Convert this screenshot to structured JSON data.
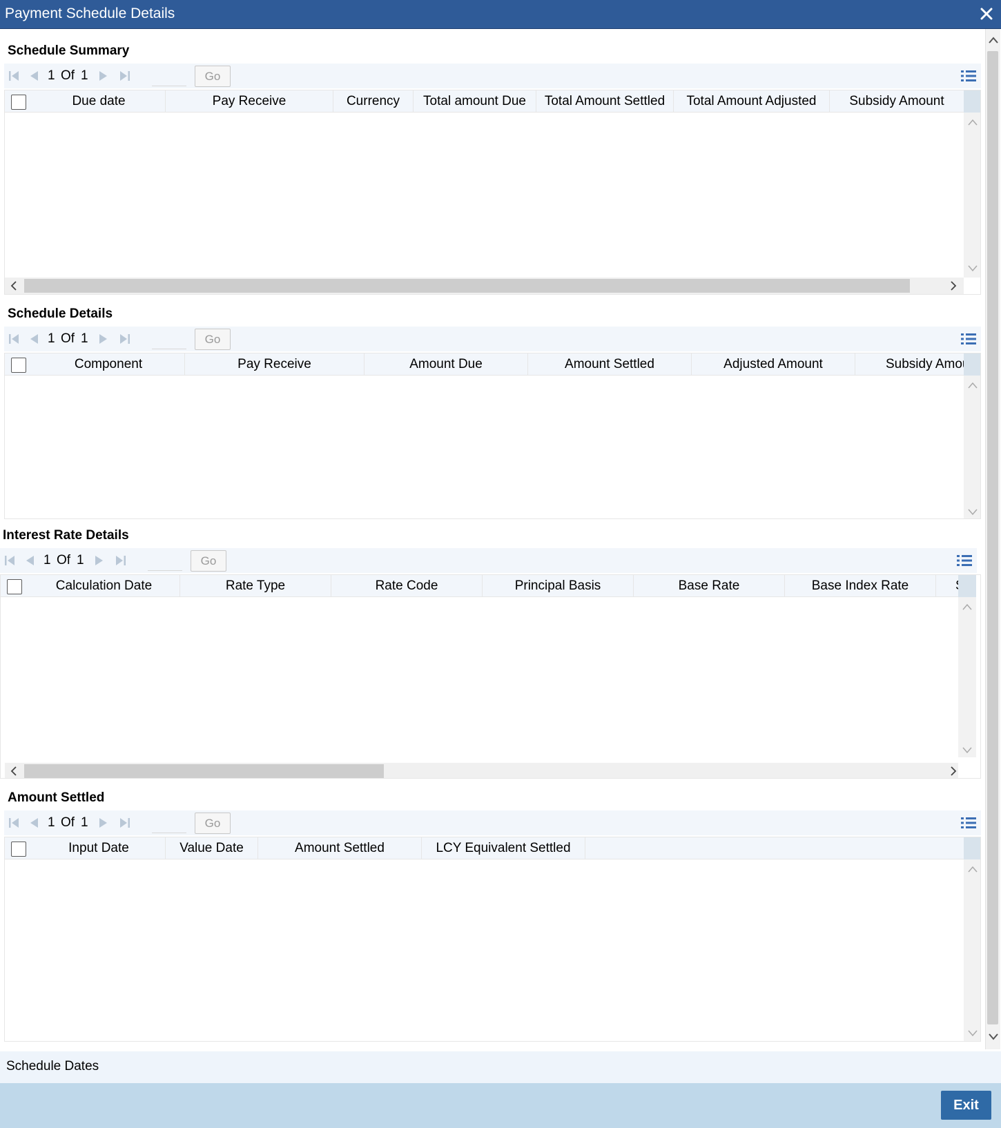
{
  "window": {
    "title": "Payment Schedule Details",
    "close_icon": "close-icon"
  },
  "common": {
    "of_label": "Of",
    "go_label": "Go"
  },
  "sections": [
    {
      "title": "Schedule Summary",
      "page_current": "1",
      "page_total": "1",
      "columns": [
        "Due date",
        "Pay Receive",
        "Currency",
        "Total amount Due",
        "Total Amount Settled",
        "Total Amount Adjusted",
        "Subsidy Amount"
      ]
    },
    {
      "title": "Schedule Details",
      "page_current": "1",
      "page_total": "1",
      "columns": [
        "Component",
        "Pay Receive",
        "Amount Due",
        "Amount Settled",
        "Adjusted Amount",
        "Subsidy Amou"
      ]
    },
    {
      "title": "Interest Rate Details",
      "page_current": "1",
      "page_total": "1",
      "columns": [
        "Calculation Date",
        "Rate Type",
        "Rate Code",
        "Principal Basis",
        "Base Rate",
        "Base Index Rate",
        "S"
      ]
    },
    {
      "title": "Amount Settled",
      "page_current": "1",
      "page_total": "1",
      "columns": [
        "Input Date",
        "Value Date",
        "Amount Settled",
        "LCY Equivalent Settled"
      ]
    }
  ],
  "footer": {
    "schedule_dates": "Schedule Dates",
    "exit_label": "Exit"
  },
  "colors": {
    "titlebar": "#2f5b98",
    "toolbar_bg": "#f2f6fb",
    "bottom_bar": "#bfd8ea",
    "exit_button": "#2f6aa6"
  }
}
